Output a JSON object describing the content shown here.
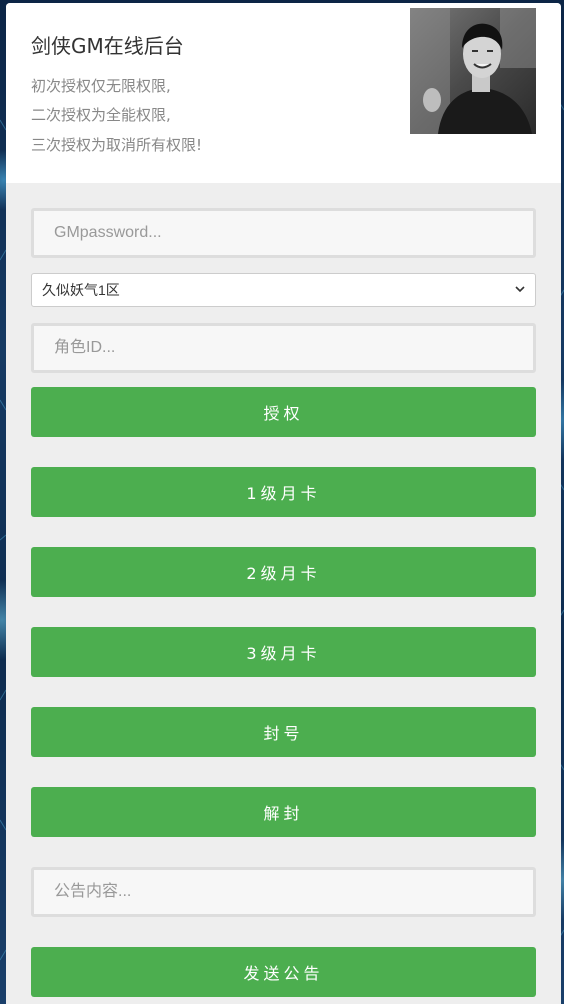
{
  "header": {
    "title": "剑侠GM在线后台",
    "desc_lines": [
      "初次授权仅无限权限,",
      "二次授权为全能权限,",
      "三次授权为取消所有权限!"
    ]
  },
  "form": {
    "password_placeholder": "GMpassword...",
    "server_select_value": "久似妖气1区",
    "role_id_placeholder": "角色ID...",
    "notice_placeholder": "公告内容..."
  },
  "buttons": {
    "authorize": "授权",
    "month_card_1": "1级月卡",
    "month_card_2": "2级月卡",
    "month_card_3": "3级月卡",
    "ban": "封号",
    "unban": "解封",
    "send_notice": "发送公告"
  },
  "colors": {
    "accent_green": "#4cae4f",
    "panel_bg": "#eeeeee",
    "header_bg": "#ffffff"
  },
  "icons": {
    "select_arrow": "chevron-down-icon"
  }
}
